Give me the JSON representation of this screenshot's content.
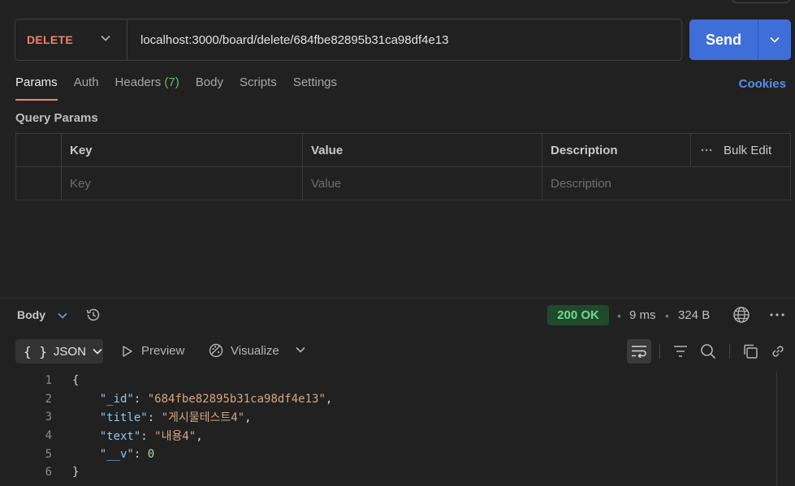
{
  "request": {
    "method": "DELETE",
    "url": "localhost:3000/board/delete/684fbe82895b31ca98df4e13",
    "send_label": "Send"
  },
  "tabs": [
    {
      "label": "Params",
      "active": true
    },
    {
      "label": "Auth"
    },
    {
      "label": "Headers",
      "count": "(7)"
    },
    {
      "label": "Body"
    },
    {
      "label": "Scripts"
    },
    {
      "label": "Settings"
    }
  ],
  "cookies_label": "Cookies",
  "query_params": {
    "title": "Query Params",
    "headers": [
      "Key",
      "Value",
      "Description"
    ],
    "bulk_edit": "Bulk Edit",
    "placeholders": {
      "key": "Key",
      "value": "Value",
      "description": "Description"
    }
  },
  "response": {
    "section_label": "Body",
    "status": "200 OK",
    "time": "9 ms",
    "size": "324 B",
    "format": "JSON",
    "preview_label": "Preview",
    "visualize_label": "Visualize",
    "lines": [
      "1",
      "2",
      "3",
      "4",
      "5",
      "6"
    ],
    "json": {
      "open": "{",
      "id_key": "\"_id\"",
      "id_value": "\"684fbe82895b31ca98df4e13\"",
      "title_key": "\"title\"",
      "title_value": "\"게시물테스트4\"",
      "text_key": "\"text\"",
      "text_value": "\"내용4\"",
      "v_key": "\"__v\"",
      "v_value": "0",
      "close": "}"
    }
  },
  "colors": {
    "method": "#f0826c",
    "send": "#3f6ed8",
    "active_tab": "#f08a5d",
    "status_bg": "#1f4a2c",
    "status_text": "#70d98a",
    "cookies": "#5a8ee6"
  }
}
